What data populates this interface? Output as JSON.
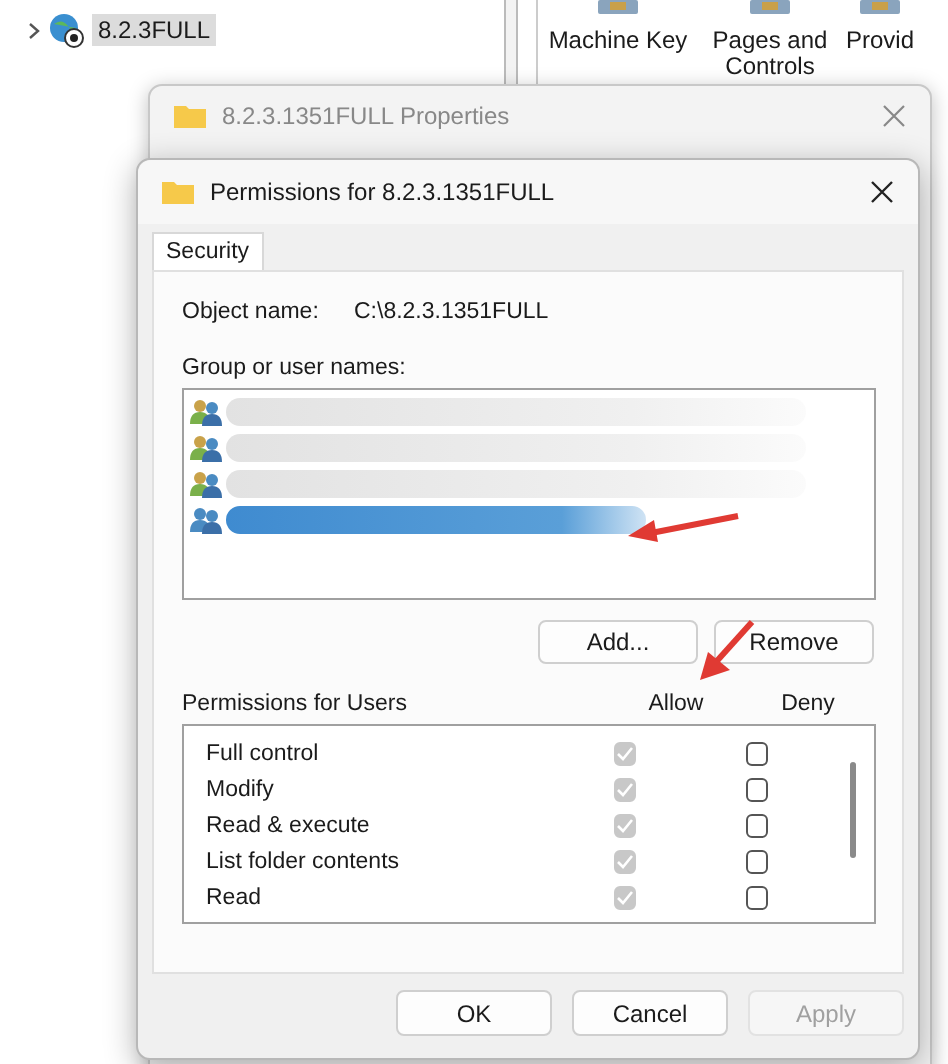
{
  "tree": {
    "items": [
      {
        "label": "8.2.3FULL",
        "selected": true
      }
    ]
  },
  "features": [
    {
      "label": "Machine Key"
    },
    {
      "label": "Pages and Controls"
    },
    {
      "label": "Provid"
    }
  ],
  "properties_window": {
    "title": "8.2.3.1351FULL Properties"
  },
  "dialog": {
    "title": "Permissions for 8.2.3.1351FULL",
    "tabs": [
      {
        "label": "Security",
        "selected": true
      }
    ],
    "object_name_label": "Object name:",
    "object_name": "C:\\8.2.3.1351FULL",
    "group_label": "Group or user names:",
    "users": [
      {
        "selected": false
      },
      {
        "selected": false
      },
      {
        "selected": false
      },
      {
        "selected": true
      }
    ],
    "buttons": [
      {
        "label": "Add...",
        "disabled": false
      },
      {
        "label": "Remove",
        "disabled": false
      }
    ],
    "permissions_label": "Permissions for Users",
    "columns": [
      "Allow",
      "Deny"
    ],
    "permissions": [
      {
        "name": "Full control",
        "allow": true,
        "deny": false
      },
      {
        "name": "Modify",
        "allow": true,
        "deny": false
      },
      {
        "name": "Read & execute",
        "allow": true,
        "deny": false
      },
      {
        "name": "List folder contents",
        "allow": true,
        "deny": false
      },
      {
        "name": "Read",
        "allow": true,
        "deny": false
      }
    ],
    "permissions_locked": true,
    "footer_buttons": [
      {
        "label": "OK",
        "disabled": false
      },
      {
        "label": "Cancel",
        "disabled": false
      },
      {
        "label": "Apply",
        "disabled": true
      }
    ]
  }
}
